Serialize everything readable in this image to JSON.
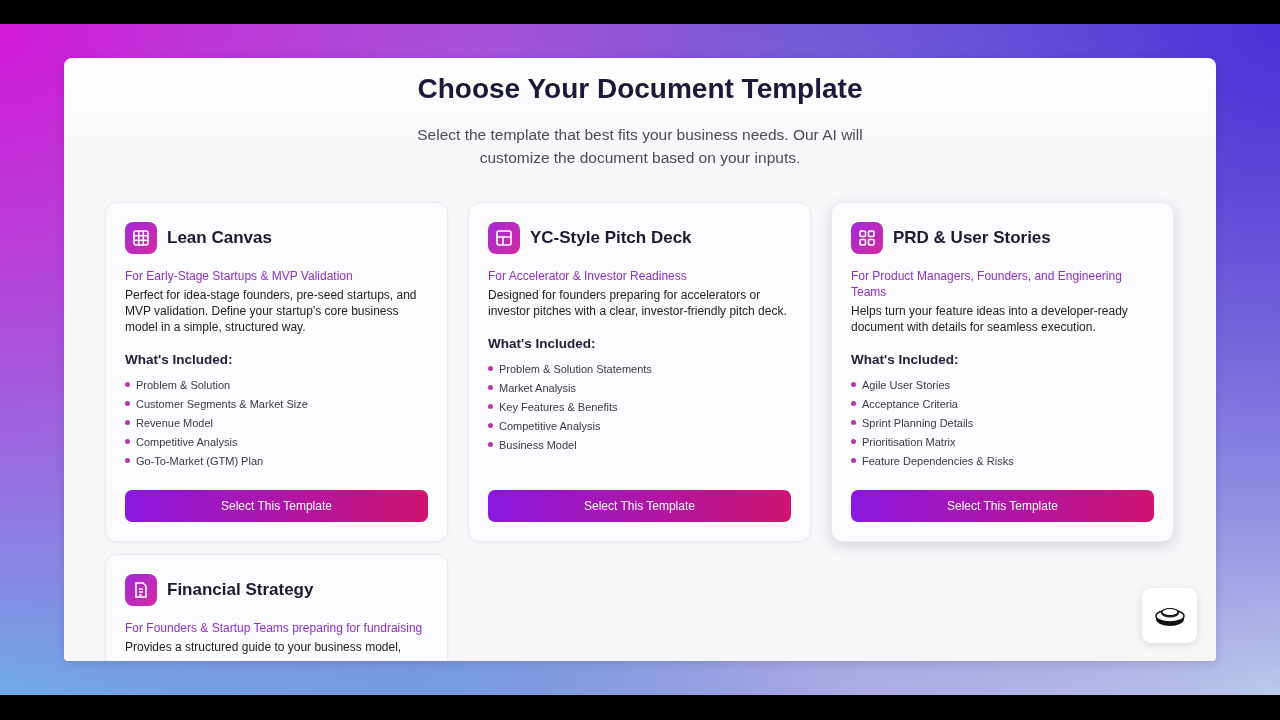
{
  "header": {
    "title": "Choose Your Document Template",
    "subtitle": "Select the template that best fits your business needs. Our AI will customize the document based on your inputs."
  },
  "templates": [
    {
      "kind": "grid",
      "title": "Lean Canvas",
      "audience": "For Early-Stage Startups & MVP Validation",
      "description": "Perfect for idea-stage founders, pre-seed startups, and MVP validation. Define your startup's core business model in a simple, structured way.",
      "included_heading": "What's Included:",
      "included": [
        "Problem & Solution",
        "Customer Segments & Market Size",
        "Revenue Model",
        "Competitive Analysis",
        "Go-To-Market (GTM) Plan"
      ],
      "button": "Select This Template",
      "highlighted": false
    },
    {
      "kind": "layout",
      "title": "YC-Style Pitch Deck",
      "audience": "For Accelerator & Investor Readiness",
      "description": "Designed for founders preparing for accelerators or investor pitches with a clear, investor-friendly pitch deck.",
      "included_heading": "What's Included:",
      "included": [
        "Problem & Solution Statements",
        "Market Analysis",
        "Key Features & Benefits",
        "Competitive Analysis",
        "Business Model"
      ],
      "button": "Select This Template",
      "highlighted": false
    },
    {
      "kind": "squares",
      "title": "PRD & User Stories",
      "audience": "For Product Managers, Founders, and Engineering Teams",
      "description": "Helps turn your feature ideas into a developer-ready document with details for seamless execution.",
      "included_heading": "What's Included:",
      "included": [
        "Agile User Stories",
        "Acceptance Criteria",
        "Sprint Planning Details",
        "Prioritisation Matrix",
        "Feature Dependencies & Risks"
      ],
      "button": "Select This Template",
      "highlighted": true
    },
    {
      "kind": "document",
      "title": "Financial Strategy",
      "audience": "For Founders & Startup Teams preparing for fundraising",
      "description": "Provides a structured guide to your business model,",
      "highlighted": false
    }
  ]
}
